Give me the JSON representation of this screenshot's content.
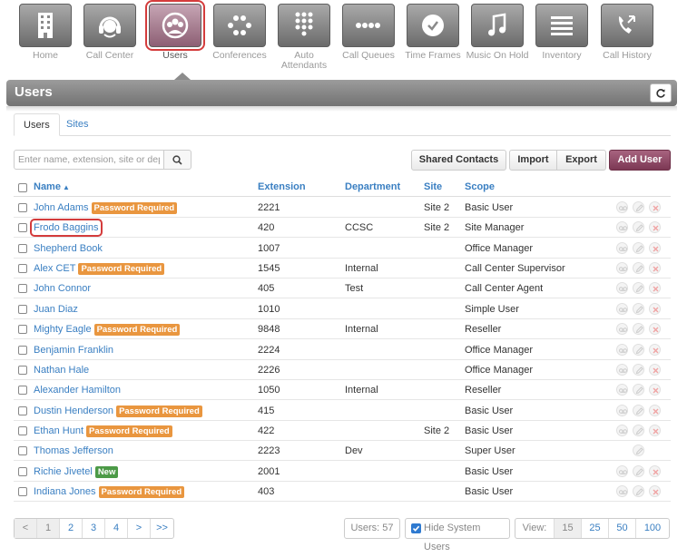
{
  "nav": [
    {
      "label": "Home",
      "icon": "building-icon"
    },
    {
      "label": "Call Center",
      "icon": "headset-icon"
    },
    {
      "label": "Users",
      "icon": "users-group-icon",
      "active": true
    },
    {
      "label": "Conferences",
      "icon": "conference-dots-icon"
    },
    {
      "label": "Auto Attendants",
      "icon": "keypad-icon"
    },
    {
      "label": "Call Queues",
      "icon": "queue-dots-icon"
    },
    {
      "label": "Time Frames",
      "icon": "clock-icon"
    },
    {
      "label": "Music On Hold",
      "icon": "music-note-icon"
    },
    {
      "label": "Inventory",
      "icon": "list-icon"
    },
    {
      "label": "Call History",
      "icon": "phone-history-icon"
    }
  ],
  "title": "Users",
  "tabs": [
    {
      "label": "Users"
    },
    {
      "label": "Sites"
    }
  ],
  "search": {
    "placeholder": "Enter name, extension, site or dept.",
    "value": ""
  },
  "actions": {
    "shared_contacts": "Shared Contacts",
    "import": "Import",
    "export": "Export",
    "add_user": "Add User"
  },
  "table": {
    "columns": {
      "name": "Name",
      "extension": "Extension",
      "department": "Department",
      "site": "Site",
      "scope": "Scope"
    },
    "sort_indicator": "▲",
    "rows": [
      {
        "name": "John Adams",
        "badge": "Password Required",
        "badge_type": "warn",
        "extension": "2221",
        "department": "",
        "site": "Site 2",
        "scope": "Basic User"
      },
      {
        "name": "Frodo Baggins",
        "badge": "",
        "badge_type": "",
        "extension": "420",
        "department": "CCSC",
        "site": "Site 2",
        "scope": "Site Manager",
        "highlight": true
      },
      {
        "name": "Shepherd Book",
        "badge": "",
        "badge_type": "",
        "extension": "1007",
        "department": "",
        "site": "",
        "scope": "Office Manager"
      },
      {
        "name": "Alex CET",
        "badge": "Password Required",
        "badge_type": "warn",
        "extension": "1545",
        "department": "Internal",
        "site": "",
        "scope": "Call Center Supervisor"
      },
      {
        "name": "John Connor",
        "badge": "",
        "badge_type": "",
        "extension": "405",
        "department": "Test",
        "site": "",
        "scope": "Call Center Agent"
      },
      {
        "name": "Juan Diaz",
        "badge": "",
        "badge_type": "",
        "extension": "1010",
        "department": "",
        "site": "",
        "scope": "Simple User"
      },
      {
        "name": "Mighty Eagle",
        "badge": "Password Required",
        "badge_type": "warn",
        "extension": "9848",
        "department": "Internal",
        "site": "",
        "scope": "Reseller"
      },
      {
        "name": "Benjamin Franklin",
        "badge": "",
        "badge_type": "",
        "extension": "2224",
        "department": "",
        "site": "",
        "scope": "Office Manager"
      },
      {
        "name": "Nathan Hale",
        "badge": "",
        "badge_type": "",
        "extension": "2226",
        "department": "",
        "site": "",
        "scope": "Office Manager"
      },
      {
        "name": "Alexander Hamilton",
        "badge": "",
        "badge_type": "",
        "extension": "1050",
        "department": "Internal",
        "site": "",
        "scope": "Reseller"
      },
      {
        "name": "Dustin Henderson",
        "badge": "Password Required",
        "badge_type": "warn",
        "extension": "415",
        "department": "",
        "site": "",
        "scope": "Basic User"
      },
      {
        "name": "Ethan Hunt",
        "badge": "Password Required",
        "badge_type": "warn",
        "extension": "422",
        "department": "",
        "site": "Site 2",
        "scope": "Basic User"
      },
      {
        "name": "Thomas Jefferson",
        "badge": "",
        "badge_type": "",
        "extension": "2223",
        "department": "Dev",
        "site": "",
        "scope": "Super User",
        "only_edit": true
      },
      {
        "name": "Richie Jivetel",
        "badge": "New",
        "badge_type": "new",
        "extension": "2001",
        "department": "",
        "site": "",
        "scope": "Basic User"
      },
      {
        "name": "Indiana Jones",
        "badge": "Password Required",
        "badge_type": "warn",
        "extension": "403",
        "department": "",
        "site": "",
        "scope": "Basic User"
      }
    ]
  },
  "pagination": {
    "prev": "<",
    "pages": [
      "1",
      "2",
      "3",
      "4"
    ],
    "current": "1",
    "next": ">",
    "last": ">>"
  },
  "footer": {
    "users_count": "Users: 57",
    "hide_system_users": "Hide System Users",
    "hide_system_checked": true,
    "view_label": "View:",
    "view_options": [
      "15",
      "25",
      "50",
      "100"
    ],
    "view_current": "15"
  },
  "colors": {
    "accent": "#3a7fc2",
    "warn_badge": "#e9963f",
    "new_badge": "#4c9a47",
    "add_user": "#8d4a66",
    "highlight": "#d43c3c"
  }
}
